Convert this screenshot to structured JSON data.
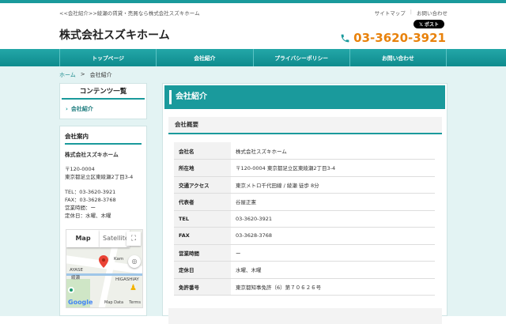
{
  "header": {
    "tagline": "<<会社紹介>>綾瀬の賃貸・売買なら株式会社スズキホーム",
    "links": [
      "サイトマップ",
      "お問い合わせ"
    ],
    "xpost": "𝕏 ポスト",
    "logo": "株式会社スズキホーム",
    "phone": "03-3620-3921"
  },
  "nav": [
    "トップページ",
    "会社紹介",
    "プライバシーポリシー",
    "お問い合わせ"
  ],
  "breadcrumb": {
    "home": "ホーム",
    "sep": ">",
    "current": "会社紹介"
  },
  "sidebar": {
    "contents_title": "コンテンツ一覧",
    "contents_item": "会社紹介",
    "info_title": "会社案内",
    "company": "株式会社スズキホーム",
    "zip": "〒120-0004",
    "address": "東京都足立区東綾瀬2丁目3-4",
    "tel": "TEL：03-3620-3921",
    "fax": "FAX：03-3628-3768",
    "hours": "営業時間：ー",
    "holiday": "定休日：水曜、木曜"
  },
  "map": {
    "map_btn": "Map",
    "sat_btn": "Satellite",
    "labels": [
      "Kam",
      "AYASE",
      "綾瀬",
      "HIGASHIAY"
    ],
    "google": "Google",
    "mapdata": "Map Data",
    "terms": "Terms"
  },
  "main": {
    "title": "会社紹介",
    "section": "会社概要",
    "rows": [
      {
        "k": "会社名",
        "v": "株式会社スズキホーム"
      },
      {
        "k": "所在地",
        "v": "〒120-0004 東京都足立区東綾瀬2丁目3-4"
      },
      {
        "k": "交通アクセス",
        "v": "東京メトロ千代田線 / 綾瀬 徒歩 8分"
      },
      {
        "k": "代表者",
        "v": "谷屋正憲"
      },
      {
        "k": "TEL",
        "v": "03-3620-3921"
      },
      {
        "k": "FAX",
        "v": "03-3628-3768"
      },
      {
        "k": "営業時間",
        "v": "ー"
      },
      {
        "k": "定休日",
        "v": "水曜、木曜"
      },
      {
        "k": "免許番号",
        "v": "東京都知事免許（6）第７０６２６号"
      }
    ]
  }
}
